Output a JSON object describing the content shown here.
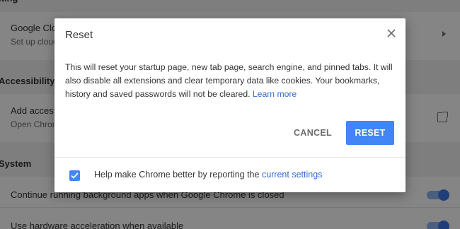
{
  "background": {
    "sections": [
      {
        "title": "Printing",
        "visible": "iting"
      },
      {
        "title": "Accessibility"
      },
      {
        "title": "System"
      }
    ],
    "items": [
      {
        "title": "Google Cloud Print",
        "subtitle": "Set up cloud printing devices"
      },
      {
        "title": "Add accessibility features",
        "subtitle": "Open Chrome Web Store"
      },
      {
        "title": "Continue running background apps when Google Chrome is closed"
      },
      {
        "title": "Use hardware acceleration when available"
      }
    ]
  },
  "dialog": {
    "title": "Reset",
    "close_icon": "close-icon",
    "body": "This will reset your startup page, new tab page, search engine, and pinned tabs. It will also disable all extensions and clear temporary data like cookies. Your bookmarks, history and saved passwords will not be cleared.",
    "learn_more": "Learn more",
    "cancel_label": "CANCEL",
    "reset_label": "RESET",
    "checkbox_checked": true,
    "checkbox_text": "Help make Chrome better by reporting the",
    "checkbox_link": "current settings"
  },
  "colors": {
    "accent": "#4285f4",
    "link": "#3367d6"
  }
}
